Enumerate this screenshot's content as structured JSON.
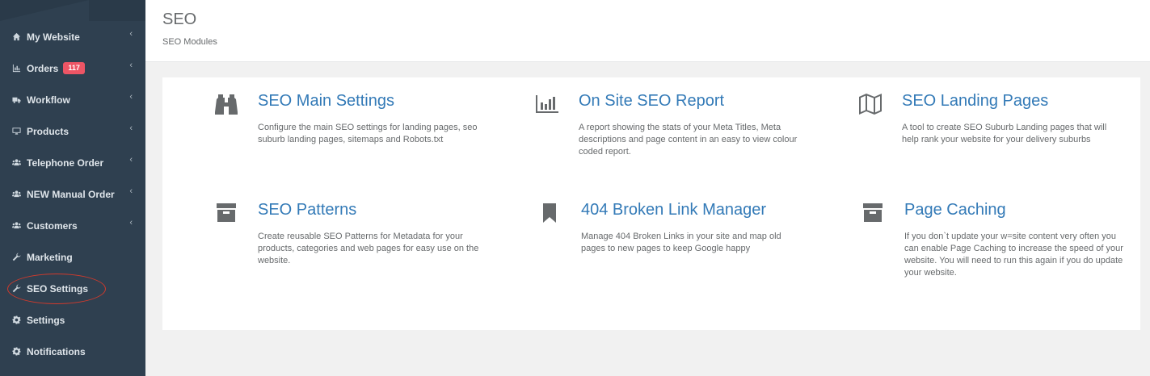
{
  "sidebar": {
    "items": [
      {
        "label": "My Website",
        "icon": "home-icon",
        "chevron": "‹"
      },
      {
        "label": "Orders",
        "icon": "bar-chart-icon",
        "badge": "117",
        "chevron": "‹"
      },
      {
        "label": "Workflow",
        "icon": "truck-icon",
        "chevron": "‹"
      },
      {
        "label": "Products",
        "icon": "monitor-icon",
        "chevron": "‹"
      },
      {
        "label": "Telephone Order",
        "icon": "users-icon",
        "chevron": "‹"
      },
      {
        "label": "NEW Manual Order",
        "icon": "users-icon",
        "chevron": "‹"
      },
      {
        "label": "Customers",
        "icon": "users-icon",
        "chevron": "‹"
      },
      {
        "label": "Marketing",
        "icon": "wrench-icon"
      },
      {
        "label": "SEO Settings",
        "icon": "wrench-icon"
      },
      {
        "label": "Settings",
        "icon": "gear-icon"
      },
      {
        "label": "Notifications",
        "icon": "gear-icon"
      }
    ],
    "highlight_color": "#d23a2c",
    "background": "#2f4050",
    "badge_color": "#ed5565"
  },
  "header": {
    "title": "SEO",
    "subtitle": "SEO Modules"
  },
  "modules": [
    {
      "title": "SEO Main Settings",
      "icon": "binoculars-icon",
      "description": "Configure the main SEO settings for landing pages, seo suburb landing pages, sitemaps and Robots.txt"
    },
    {
      "title": "On Site SEO Report",
      "icon": "bar-chart-icon",
      "description": "A report showing the stats of your Meta Titles, Meta descriptions and page content in an easy to view colour coded report."
    },
    {
      "title": "SEO Landing Pages",
      "icon": "map-icon",
      "description": "A tool to create SEO Suburb Landing pages that will help rank your website for your delivery suburbs"
    },
    {
      "title": "SEO Patterns",
      "icon": "archive-icon",
      "description": "Create reusable SEO Patterns for Metadata for your products, categories and web pages for easy use on the website."
    },
    {
      "title": "404 Broken Link Manager",
      "icon": "bookmark-icon",
      "description": "Manage 404 Broken Links in your site and map old pages to new pages to keep Google happy"
    },
    {
      "title": "Page Caching",
      "icon": "archive-icon",
      "description": "If you don`t update your w=site content very often you can enable Page Caching to increase the speed of your website. You will need to run this again if you do update your website."
    }
  ],
  "colors": {
    "link": "#337ab7",
    "text": "#676a6c"
  }
}
